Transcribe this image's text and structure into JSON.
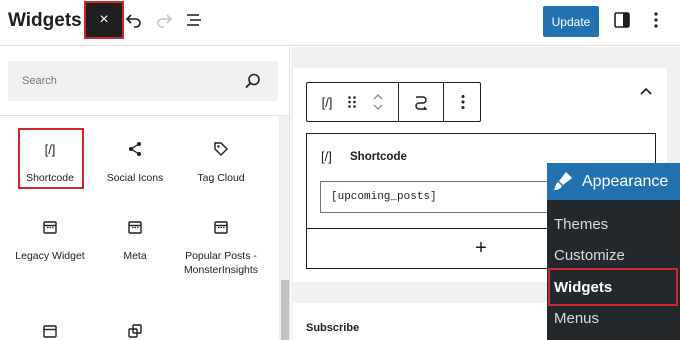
{
  "header": {
    "title": "Widgets",
    "close_glyph": "×",
    "update_label": "Update",
    "icons": [
      "close-icon",
      "undo-icon",
      "redo-icon",
      "list-view-icon",
      "sidebar-toggle-icon",
      "more-options-icon"
    ]
  },
  "inserter": {
    "search_placeholder": "Search",
    "blocks": [
      {
        "label": "Shortcode",
        "icon": "shortcode-icon",
        "glyph": "[/]"
      },
      {
        "label": "Social Icons",
        "icon": "share-icon"
      },
      {
        "label": "Tag Cloud",
        "icon": "tag-icon"
      },
      {
        "label": "Legacy Widget",
        "icon": "calendar-icon"
      },
      {
        "label": "Meta",
        "icon": "calendar-icon"
      },
      {
        "label": "Popular Posts - MonsterInsights",
        "icon": "calendar-icon"
      }
    ]
  },
  "editor": {
    "toolbar_glyph": "[/]",
    "shortcode_block": {
      "title": "Shortcode",
      "glyph": "[/]",
      "value": "[upcoming_posts]"
    },
    "add_block_glyph": "+",
    "next_block_title": "Subscribe"
  },
  "admin_menu": {
    "header": "Appearance",
    "items": [
      "Themes",
      "Customize",
      "Widgets",
      "Menus"
    ],
    "active": "Widgets"
  },
  "colors": {
    "accent": "#2271b1",
    "highlight_outline": "#d0262d",
    "admin_bg": "#23282d"
  }
}
